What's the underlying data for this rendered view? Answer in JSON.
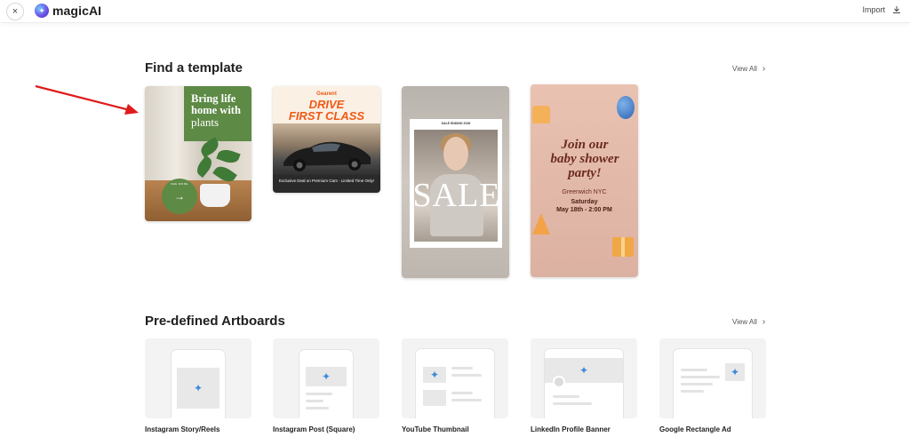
{
  "app": {
    "name": "magicAI",
    "close_icon": "×",
    "import_label": "Import"
  },
  "templates_section": {
    "title": "Find a template",
    "view_all": "View All",
    "cards": [
      {
        "name": "plant",
        "headline_bold": "Bring life home with",
        "headline_light": "plants",
        "button_caption": "SEE MORE"
      },
      {
        "name": "car",
        "brand": "Gearent",
        "headline_line1": "DRIVE",
        "headline_line2": "FIRST CLASS",
        "footer": "Exclusive Deal on Premium Cars - Limited Time Only!"
      },
      {
        "name": "sale",
        "top_text": "SALE ENDING 2026",
        "word": "SALE"
      },
      {
        "name": "baby-shower",
        "headline_line1": "Join our",
        "headline_line2": "baby shower",
        "headline_line3": "party!",
        "location": "Greenwich NYC",
        "day": "Saturday",
        "date": "May 18th - 2:00 PM"
      }
    ]
  },
  "artboards_section": {
    "title": "Pre-defined Artboards",
    "view_all": "View All",
    "items": [
      {
        "label": "Instagram Story/Reels"
      },
      {
        "label": "Instagram Post (Square)"
      },
      {
        "label": "YouTube Thumbnail"
      },
      {
        "label": "LinkedIn Profile Banner"
      },
      {
        "label": "Google Rectangle Ad"
      }
    ]
  },
  "colors": {
    "accent_red": "#e01b1b",
    "spark_blue": "#3d8bdb",
    "plant_green": "#5d8a45"
  }
}
